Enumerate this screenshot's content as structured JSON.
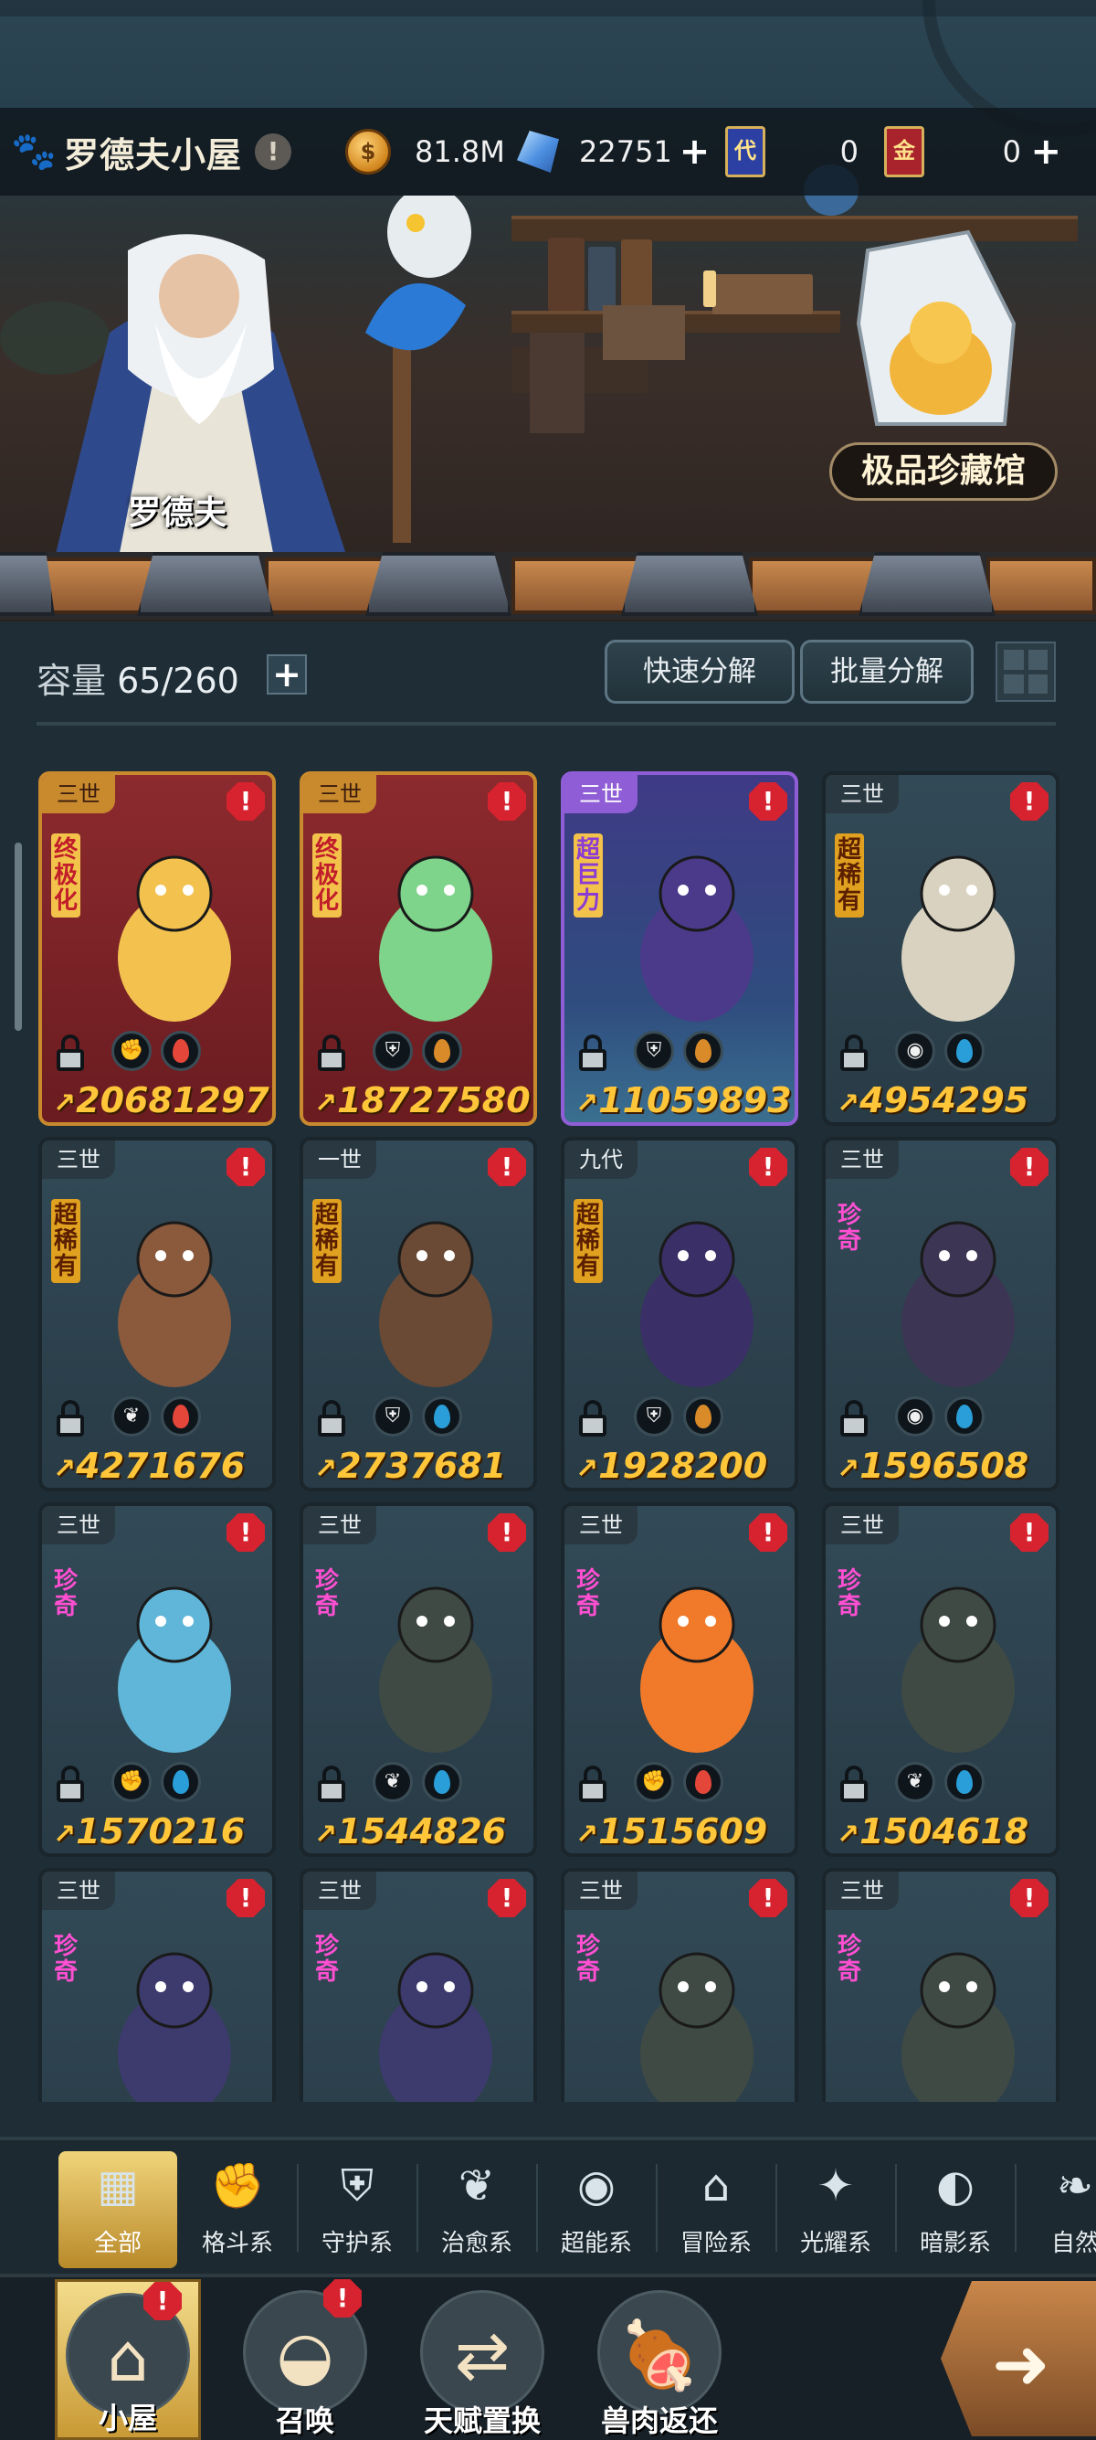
{
  "header": {
    "title": "罗德夫小屋",
    "info_icon": "exclamation-icon",
    "resources": [
      {
        "name": "coins",
        "icon": "gold-coin-icon",
        "value": "81.8M"
      },
      {
        "name": "gems",
        "icon": "diamond-icon",
        "value": "22751"
      },
      {
        "name": "blue_ticket",
        "icon": "blue-card-icon",
        "glyph": "代",
        "value": "0"
      },
      {
        "name": "red_ticket",
        "icon": "red-card-icon",
        "glyph": "金",
        "value": "0"
      }
    ],
    "character_name": "罗德夫",
    "museum_label": "极品珍藏馆"
  },
  "inventory": {
    "capacity_label": "容量",
    "capacity_value": "65/260",
    "quick_decompose": "快速分解",
    "batch_decompose": "批量分解",
    "cards": [
      {
        "gen": "三世",
        "rarity": "终极化",
        "power": "20681297",
        "style": "red",
        "type_icon": "fist-icon",
        "element": "fire",
        "color": "#f2c14e"
      },
      {
        "gen": "三世",
        "rarity": "终极化",
        "power": "18727580",
        "style": "red",
        "type_icon": "shield-icon",
        "element": "earth",
        "color": "#7ed48a"
      },
      {
        "gen": "三世",
        "rarity": "超巨力",
        "power": "11059893",
        "style": "purple",
        "type_icon": "shield-icon",
        "element": "earth",
        "color": "#4b3a8a"
      },
      {
        "gen": "三世",
        "rarity": "超稀有",
        "power": "4954295",
        "style": "normal",
        "type_icon": "psychic-icon",
        "element": "water",
        "color": "#d9d2c0"
      },
      {
        "gen": "三世",
        "rarity": "超稀有",
        "power": "4271676",
        "style": "normal",
        "type_icon": "leaf-icon",
        "element": "fire",
        "color": "#8b5a3c"
      },
      {
        "gen": "一世",
        "rarity": "超稀有",
        "power": "2737681",
        "style": "normal",
        "type_icon": "shield-icon",
        "element": "water",
        "color": "#6a4a34"
      },
      {
        "gen": "九代",
        "rarity": "超稀有",
        "power": "1928200",
        "style": "normal",
        "type_icon": "shield-icon",
        "element": "earth",
        "color": "#3a2f66"
      },
      {
        "gen": "三世",
        "rarity": "珍奇",
        "power": "1596508",
        "style": "normal",
        "type_icon": "psychic-icon",
        "element": "water",
        "color": "#3c3554"
      },
      {
        "gen": "三世",
        "rarity": "珍奇",
        "power": "1570216",
        "style": "normal",
        "type_icon": "fist-icon",
        "element": "water",
        "color": "#5fb6d8"
      },
      {
        "gen": "三世",
        "rarity": "珍奇",
        "power": "1544826",
        "style": "normal",
        "type_icon": "leaf-icon",
        "element": "water",
        "color": "#3f4a44"
      },
      {
        "gen": "三世",
        "rarity": "珍奇",
        "power": "1515609",
        "style": "normal",
        "type_icon": "fist-icon",
        "element": "fire",
        "color": "#f07a2a"
      },
      {
        "gen": "三世",
        "rarity": "珍奇",
        "power": "1504618",
        "style": "normal",
        "type_icon": "leaf-icon",
        "element": "water",
        "color": "#3f4a44"
      },
      {
        "gen": "三世",
        "rarity": "珍奇",
        "power": "",
        "style": "normal",
        "type_icon": "",
        "element": "",
        "color": "#3d3a6e"
      },
      {
        "gen": "三世",
        "rarity": "珍奇",
        "power": "",
        "style": "normal",
        "type_icon": "",
        "element": "",
        "color": "#3d3a6e"
      },
      {
        "gen": "三世",
        "rarity": "珍奇",
        "power": "",
        "style": "normal",
        "type_icon": "",
        "element": "",
        "color": "#3f4a44"
      },
      {
        "gen": "三世",
        "rarity": "珍奇",
        "power": "",
        "style": "normal",
        "type_icon": "",
        "element": "",
        "color": "#3f4a44"
      }
    ]
  },
  "categories": [
    {
      "label": "全部",
      "icon": "grid-icon",
      "active": true
    },
    {
      "label": "格斗系",
      "icon": "fist-icon"
    },
    {
      "label": "守护系",
      "icon": "shield-icon"
    },
    {
      "label": "治愈系",
      "icon": "sprout-icon"
    },
    {
      "label": "超能系",
      "icon": "psychic-icon"
    },
    {
      "label": "冒险系",
      "icon": "lantern-icon"
    },
    {
      "label": "光耀系",
      "icon": "star-icon"
    },
    {
      "label": "暗影系",
      "icon": "shadow-icon"
    },
    {
      "label": "自然",
      "icon": "leaf-icon"
    }
  ],
  "nav": [
    {
      "label": "小屋",
      "icon": "house-icon",
      "active": true,
      "alert": true
    },
    {
      "label": "召唤",
      "icon": "egg-icon",
      "alert": true
    },
    {
      "label": "天赋置换",
      "icon": "swap-icon"
    },
    {
      "label": "兽肉返还",
      "icon": "meat-icon"
    }
  ],
  "colors": {
    "power": "#ffc63a",
    "alert": "#d6232f",
    "accent_gold": "#e0b650"
  }
}
